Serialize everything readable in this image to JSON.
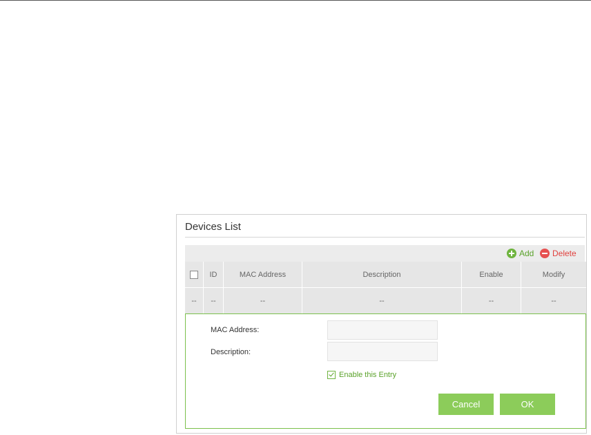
{
  "panel": {
    "title": "Devices List"
  },
  "toolbar": {
    "add_label": "Add",
    "delete_label": "Delete"
  },
  "table": {
    "headers": [
      "ID",
      "MAC Address",
      "Description",
      "Enable",
      "Modify"
    ],
    "rows": [
      [
        "--",
        "--",
        "--",
        "--",
        "--",
        "--"
      ]
    ]
  },
  "form": {
    "mac_label": "MAC Address:",
    "mac_value": "",
    "description_label": "Description:",
    "description_value": "",
    "enable_label": "Enable this Entry",
    "enable_checked": true,
    "cancel_label": "Cancel",
    "ok_label": "OK"
  },
  "colors": {
    "accent_green": "#8ccc5a",
    "add_green": "#5aa22a",
    "delete_red": "#e0413e",
    "form_border": "#7ac04b"
  },
  "icons": {
    "add": "plus-circle-icon",
    "delete": "minus-circle-icon",
    "checkbox": "checkbox-icon"
  }
}
